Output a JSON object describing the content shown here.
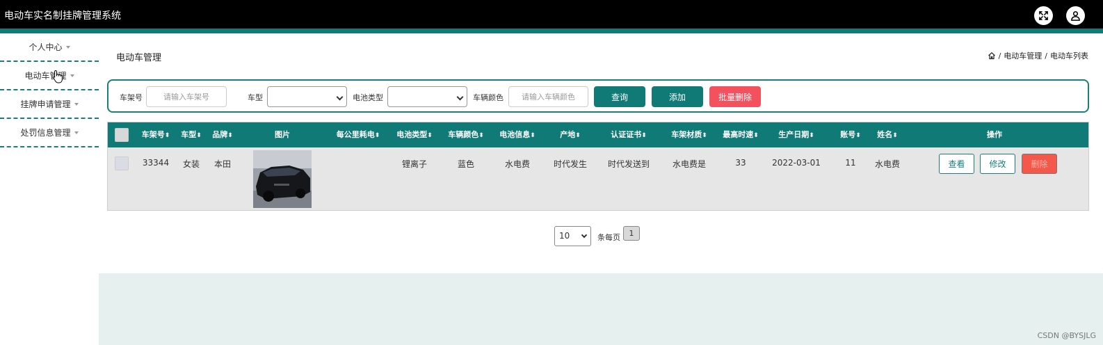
{
  "app": {
    "title": "电动车实名制挂牌管理系统"
  },
  "sidebar": {
    "items": [
      {
        "label": "个人中心"
      },
      {
        "label": "电动车管理"
      },
      {
        "label": "挂牌申请管理"
      },
      {
        "label": "处罚信息管理"
      }
    ]
  },
  "page": {
    "title": "电动车管理",
    "breadcrumb": [
      "电动车管理",
      "电动车列表"
    ],
    "breadcrumb_sep": "/"
  },
  "search": {
    "frame_label": "车架号",
    "frame_placeholder": "请输入车架号",
    "model_label": "车型",
    "battery_label": "电池类型",
    "color_label": "车辆颜色",
    "color_placeholder": "请输入车辆颜色",
    "query_button": "查询",
    "add_button": "添加",
    "batch_delete_button": "批量删除"
  },
  "table": {
    "columns": [
      "车架号",
      "车型",
      "品牌",
      "图片",
      "每公里耗电",
      "电池类型",
      "车辆颜色",
      "电池信息",
      "产地",
      "认证证书",
      "车架材质",
      "最高时速",
      "生产日期",
      "账号",
      "姓名",
      "操作"
    ],
    "sort_glyph": "⬍",
    "rows": [
      {
        "frame_no": "33344",
        "model": "女装",
        "brand": "本田",
        "power_per_km": "",
        "battery_type": "锂离子",
        "color": "蓝色",
        "battery_info": "水电费",
        "origin": "时代发生",
        "certificate": "时代发送到",
        "frame_material": "水电费是",
        "max_speed": "33",
        "production_date": "2022-03-01",
        "account": "11",
        "name": "水电费",
        "actions": {
          "view": "查看",
          "edit": "修改",
          "delete": "删除"
        }
      }
    ]
  },
  "pagination": {
    "page_size": "10",
    "per_page_label": "条每页",
    "current_page": "1"
  },
  "watermark": "CSDN @BYSJLG",
  "colors": {
    "teal": "#0f7a76",
    "red": "#f4515f",
    "top": "#000000"
  }
}
